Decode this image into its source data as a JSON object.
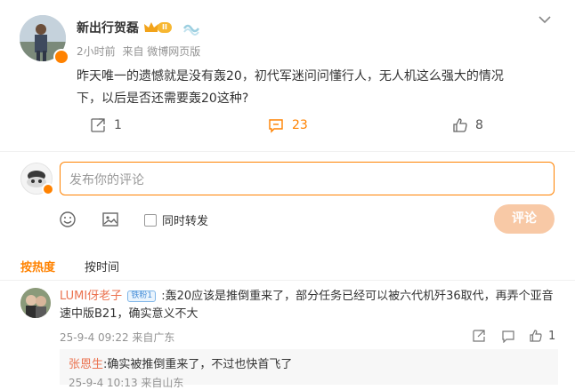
{
  "post": {
    "author": "新出行贺磊",
    "vip_badge": "II",
    "meta_time": "2小时前",
    "meta_source": "来自 微博网页版",
    "text_line1": "昨天唯一的遗憾就是没有轰20，初代军迷问问懂行人，无人机这么强大的情况",
    "text_line2": "下，以后是否还需要轰20这种?",
    "repost_count": "1",
    "comment_count": "23",
    "like_count": "8"
  },
  "composer": {
    "placeholder": "发布你的评论",
    "repost_checkbox_label": "同时转发",
    "submit_label": "评论"
  },
  "sort_tabs": {
    "hot": "按热度",
    "time": "按时间"
  },
  "comments": [
    {
      "name": "LUMI伢老子",
      "badge": "铁粉1",
      "text_line1": ":轰20应该是推倒重来了，部分任务已经可以被六代机歼36取代，再弄个亚音",
      "text_line2": "速中版B21，确实意义不大",
      "meta": "25-9-4 09:22 来自广东",
      "like_count": "1",
      "reply": {
        "name": "张恩生",
        "text": ":确实被推倒重来了，不过也快首飞了",
        "meta": "25-9-4 10:13 来自山东"
      }
    }
  ],
  "colors": {
    "accent": "#ff8200",
    "button_disabled": "#f8c9a6",
    "link_name": "#eb7350"
  }
}
